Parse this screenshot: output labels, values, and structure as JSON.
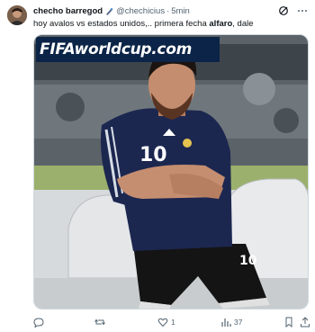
{
  "tweet": {
    "display_name": "checho barregod",
    "handle": "@chechicius",
    "separator": "·",
    "time": "5min",
    "text_before": "hoy avalos vs estados unidos,.. primera fecha ",
    "text_bold": "alfaro",
    "text_after": ", dale"
  },
  "media": {
    "watermark": "FIFAworldcup.com",
    "jersey_number": "10",
    "shorts_number": "10"
  },
  "actions": {
    "reply_count": "",
    "retweet_count": "",
    "like_count": "1",
    "views_count": "37"
  },
  "colors": {
    "accent": "#1d9bf0",
    "text": "#0f1419",
    "muted": "#536471",
    "jersey": "#1c2750"
  }
}
